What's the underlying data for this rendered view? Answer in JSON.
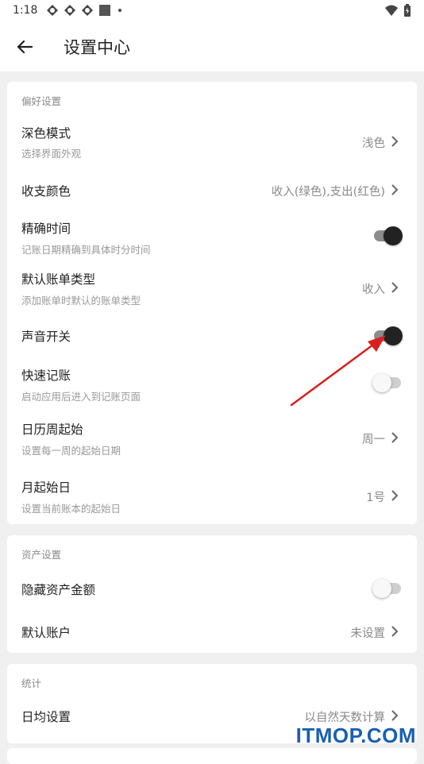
{
  "status_bar": {
    "time": "1:18"
  },
  "header": {
    "title": "设置中心"
  },
  "sections": {
    "preferences": {
      "title": "偏好设置",
      "dark_mode": {
        "title": "深色模式",
        "subtitle": "选择界面外观",
        "value": "浅色"
      },
      "income_expense_color": {
        "title": "收支颜色",
        "value": "收入(绿色),支出(红色)"
      },
      "precise_time": {
        "title": "精确时间",
        "subtitle": "记账日期精确到具体时分时间",
        "enabled": true
      },
      "default_bill_type": {
        "title": "默认账单类型",
        "subtitle": "添加账单时默认的账单类型",
        "value": "收入"
      },
      "sound_switch": {
        "title": "声音开关",
        "enabled": true
      },
      "quick_record": {
        "title": "快速记账",
        "subtitle": "启动应用后进入到记账页面",
        "enabled": false
      },
      "week_start": {
        "title": "日历周起始",
        "subtitle": "设置每一周的起始日期",
        "value": "周一"
      },
      "month_start_day": {
        "title": "月起始日",
        "subtitle": "设置当前账本的起始日",
        "value": "1号"
      }
    },
    "assets": {
      "title": "资产设置",
      "hide_amount": {
        "title": "隐藏资产金额",
        "enabled": false
      },
      "default_account": {
        "title": "默认账户",
        "value": "未设置"
      }
    },
    "statistics": {
      "title": "统计",
      "daily_average": {
        "title": "日均设置",
        "value": "以自然天数计算"
      }
    }
  },
  "watermark": "ITMOP.COM",
  "colors": {
    "annotation_arrow": "#d91f1f",
    "watermark": "#1a5fb4"
  }
}
